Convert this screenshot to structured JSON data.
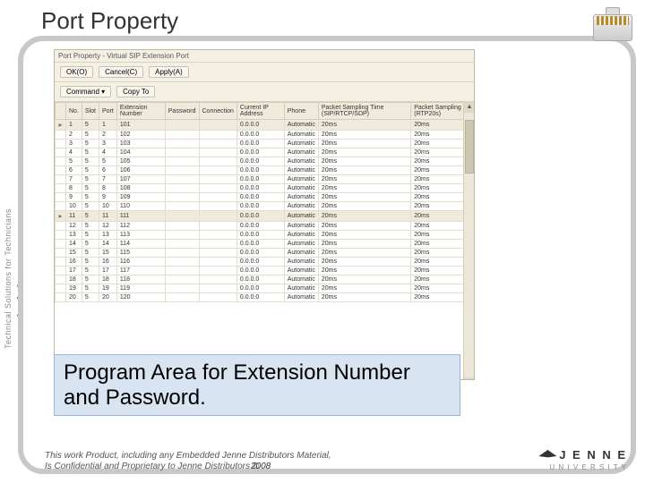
{
  "page_title": "Port Property",
  "sidebar": {
    "brand_small": "Technical Solutions for Technicians",
    "brand_main_pre": "e",
    "brand_main_post": "Technician"
  },
  "window": {
    "title": "Port Property - Virtual SIP Extension Port",
    "toolbar": {
      "ok": "OK(O)",
      "cancel": "Cancel(C)",
      "apply": "Apply(A)",
      "command": "Command ▾",
      "copyto": "Copy To"
    },
    "columns": [
      "",
      "No.",
      "Slot",
      "Port",
      "Extension Number",
      "Password",
      "Connection",
      "Current IP Address",
      "Phone",
      "Packet Sampling Time (SIP/RTCP/SDP)",
      "Packet Sampling (RTP20s)"
    ],
    "rows": [
      {
        "sel": true,
        "no": "1",
        "slot": "5",
        "port": "1",
        "ext": "101",
        "pwd": "",
        "conn": "",
        "ip": "0.0.0.0",
        "phone": "Automatic",
        "p1": "20ms",
        "p2": "20ms"
      },
      {
        "sel": false,
        "no": "2",
        "slot": "5",
        "port": "2",
        "ext": "102",
        "pwd": "",
        "conn": "",
        "ip": "0.0.0.0",
        "phone": "Automatic",
        "p1": "20ms",
        "p2": "20ms"
      },
      {
        "sel": false,
        "no": "3",
        "slot": "5",
        "port": "3",
        "ext": "103",
        "pwd": "",
        "conn": "",
        "ip": "0.0.0.0",
        "phone": "Automatic",
        "p1": "20ms",
        "p2": "20ms"
      },
      {
        "sel": false,
        "no": "4",
        "slot": "5",
        "port": "4",
        "ext": "104",
        "pwd": "",
        "conn": "",
        "ip": "0.0.0.0",
        "phone": "Automatic",
        "p1": "20ms",
        "p2": "20ms"
      },
      {
        "sel": false,
        "no": "5",
        "slot": "5",
        "port": "5",
        "ext": "105",
        "pwd": "",
        "conn": "",
        "ip": "0.0.0.0",
        "phone": "Automatic",
        "p1": "20ms",
        "p2": "20ms"
      },
      {
        "sel": false,
        "no": "6",
        "slot": "5",
        "port": "6",
        "ext": "106",
        "pwd": "",
        "conn": "",
        "ip": "0.0.0.0",
        "phone": "Automatic",
        "p1": "20ms",
        "p2": "20ms"
      },
      {
        "sel": false,
        "no": "7",
        "slot": "5",
        "port": "7",
        "ext": "107",
        "pwd": "",
        "conn": "",
        "ip": "0.0.0.0",
        "phone": "Automatic",
        "p1": "20ms",
        "p2": "20ms"
      },
      {
        "sel": false,
        "no": "8",
        "slot": "5",
        "port": "8",
        "ext": "108",
        "pwd": "",
        "conn": "",
        "ip": "0.0.0.0",
        "phone": "Automatic",
        "p1": "20ms",
        "p2": "20ms"
      },
      {
        "sel": false,
        "no": "9",
        "slot": "5",
        "port": "9",
        "ext": "109",
        "pwd": "",
        "conn": "",
        "ip": "0.0.0.0",
        "phone": "Automatic",
        "p1": "20ms",
        "p2": "20ms"
      },
      {
        "sel": false,
        "no": "10",
        "slot": "5",
        "port": "10",
        "ext": "110",
        "pwd": "",
        "conn": "",
        "ip": "0.0.0.0",
        "phone": "Automatic",
        "p1": "20ms",
        "p2": "20ms"
      },
      {
        "sel": true,
        "no": "11",
        "slot": "5",
        "port": "11",
        "ext": "111",
        "pwd": "",
        "conn": "",
        "ip": "0.0.0.0",
        "phone": "Automatic",
        "p1": "20ms",
        "p2": "20ms"
      },
      {
        "sel": false,
        "no": "12",
        "slot": "5",
        "port": "12",
        "ext": "112",
        "pwd": "",
        "conn": "",
        "ip": "0.0.0.0",
        "phone": "Automatic",
        "p1": "20ms",
        "p2": "20ms"
      },
      {
        "sel": false,
        "no": "13",
        "slot": "5",
        "port": "13",
        "ext": "113",
        "pwd": "",
        "conn": "",
        "ip": "0.0.0.0",
        "phone": "Automatic",
        "p1": "20ms",
        "p2": "20ms"
      },
      {
        "sel": false,
        "no": "14",
        "slot": "5",
        "port": "14",
        "ext": "114",
        "pwd": "",
        "conn": "",
        "ip": "0.0.0.0",
        "phone": "Automatic",
        "p1": "20ms",
        "p2": "20ms"
      },
      {
        "sel": false,
        "no": "15",
        "slot": "5",
        "port": "15",
        "ext": "115",
        "pwd": "",
        "conn": "",
        "ip": "0.0.0.0",
        "phone": "Automatic",
        "p1": "20ms",
        "p2": "20ms"
      },
      {
        "sel": false,
        "no": "16",
        "slot": "5",
        "port": "16",
        "ext": "116",
        "pwd": "",
        "conn": "",
        "ip": "0.0.0.0",
        "phone": "Automatic",
        "p1": "20ms",
        "p2": "20ms"
      },
      {
        "sel": false,
        "no": "17",
        "slot": "5",
        "port": "17",
        "ext": "117",
        "pwd": "",
        "conn": "",
        "ip": "0.0.0.0",
        "phone": "Automatic",
        "p1": "20ms",
        "p2": "20ms"
      },
      {
        "sel": false,
        "no": "18",
        "slot": "5",
        "port": "18",
        "ext": "118",
        "pwd": "",
        "conn": "",
        "ip": "0.0.0.0",
        "phone": "Automatic",
        "p1": "20ms",
        "p2": "20ms"
      },
      {
        "sel": false,
        "no": "19",
        "slot": "5",
        "port": "19",
        "ext": "119",
        "pwd": "",
        "conn": "",
        "ip": "0.0.0.0",
        "phone": "Automatic",
        "p1": "20ms",
        "p2": "20ms"
      },
      {
        "sel": false,
        "no": "20",
        "slot": "5",
        "port": "20",
        "ext": "120",
        "pwd": "",
        "conn": "",
        "ip": "0.0.0.0",
        "phone": "Automatic",
        "p1": "20ms",
        "p2": "20ms"
      }
    ]
  },
  "annotation": "Program Area for Extension Number and Password.",
  "footer": {
    "line1": "This work Product, including any Embedded Jenne Distributors Material,",
    "line2": "Is Confidential and Proprietary to Jenne Distributors ©",
    "year": "2008",
    "logo_name": "J E N N E",
    "logo_sub": "U N I V E R S I T Y"
  }
}
